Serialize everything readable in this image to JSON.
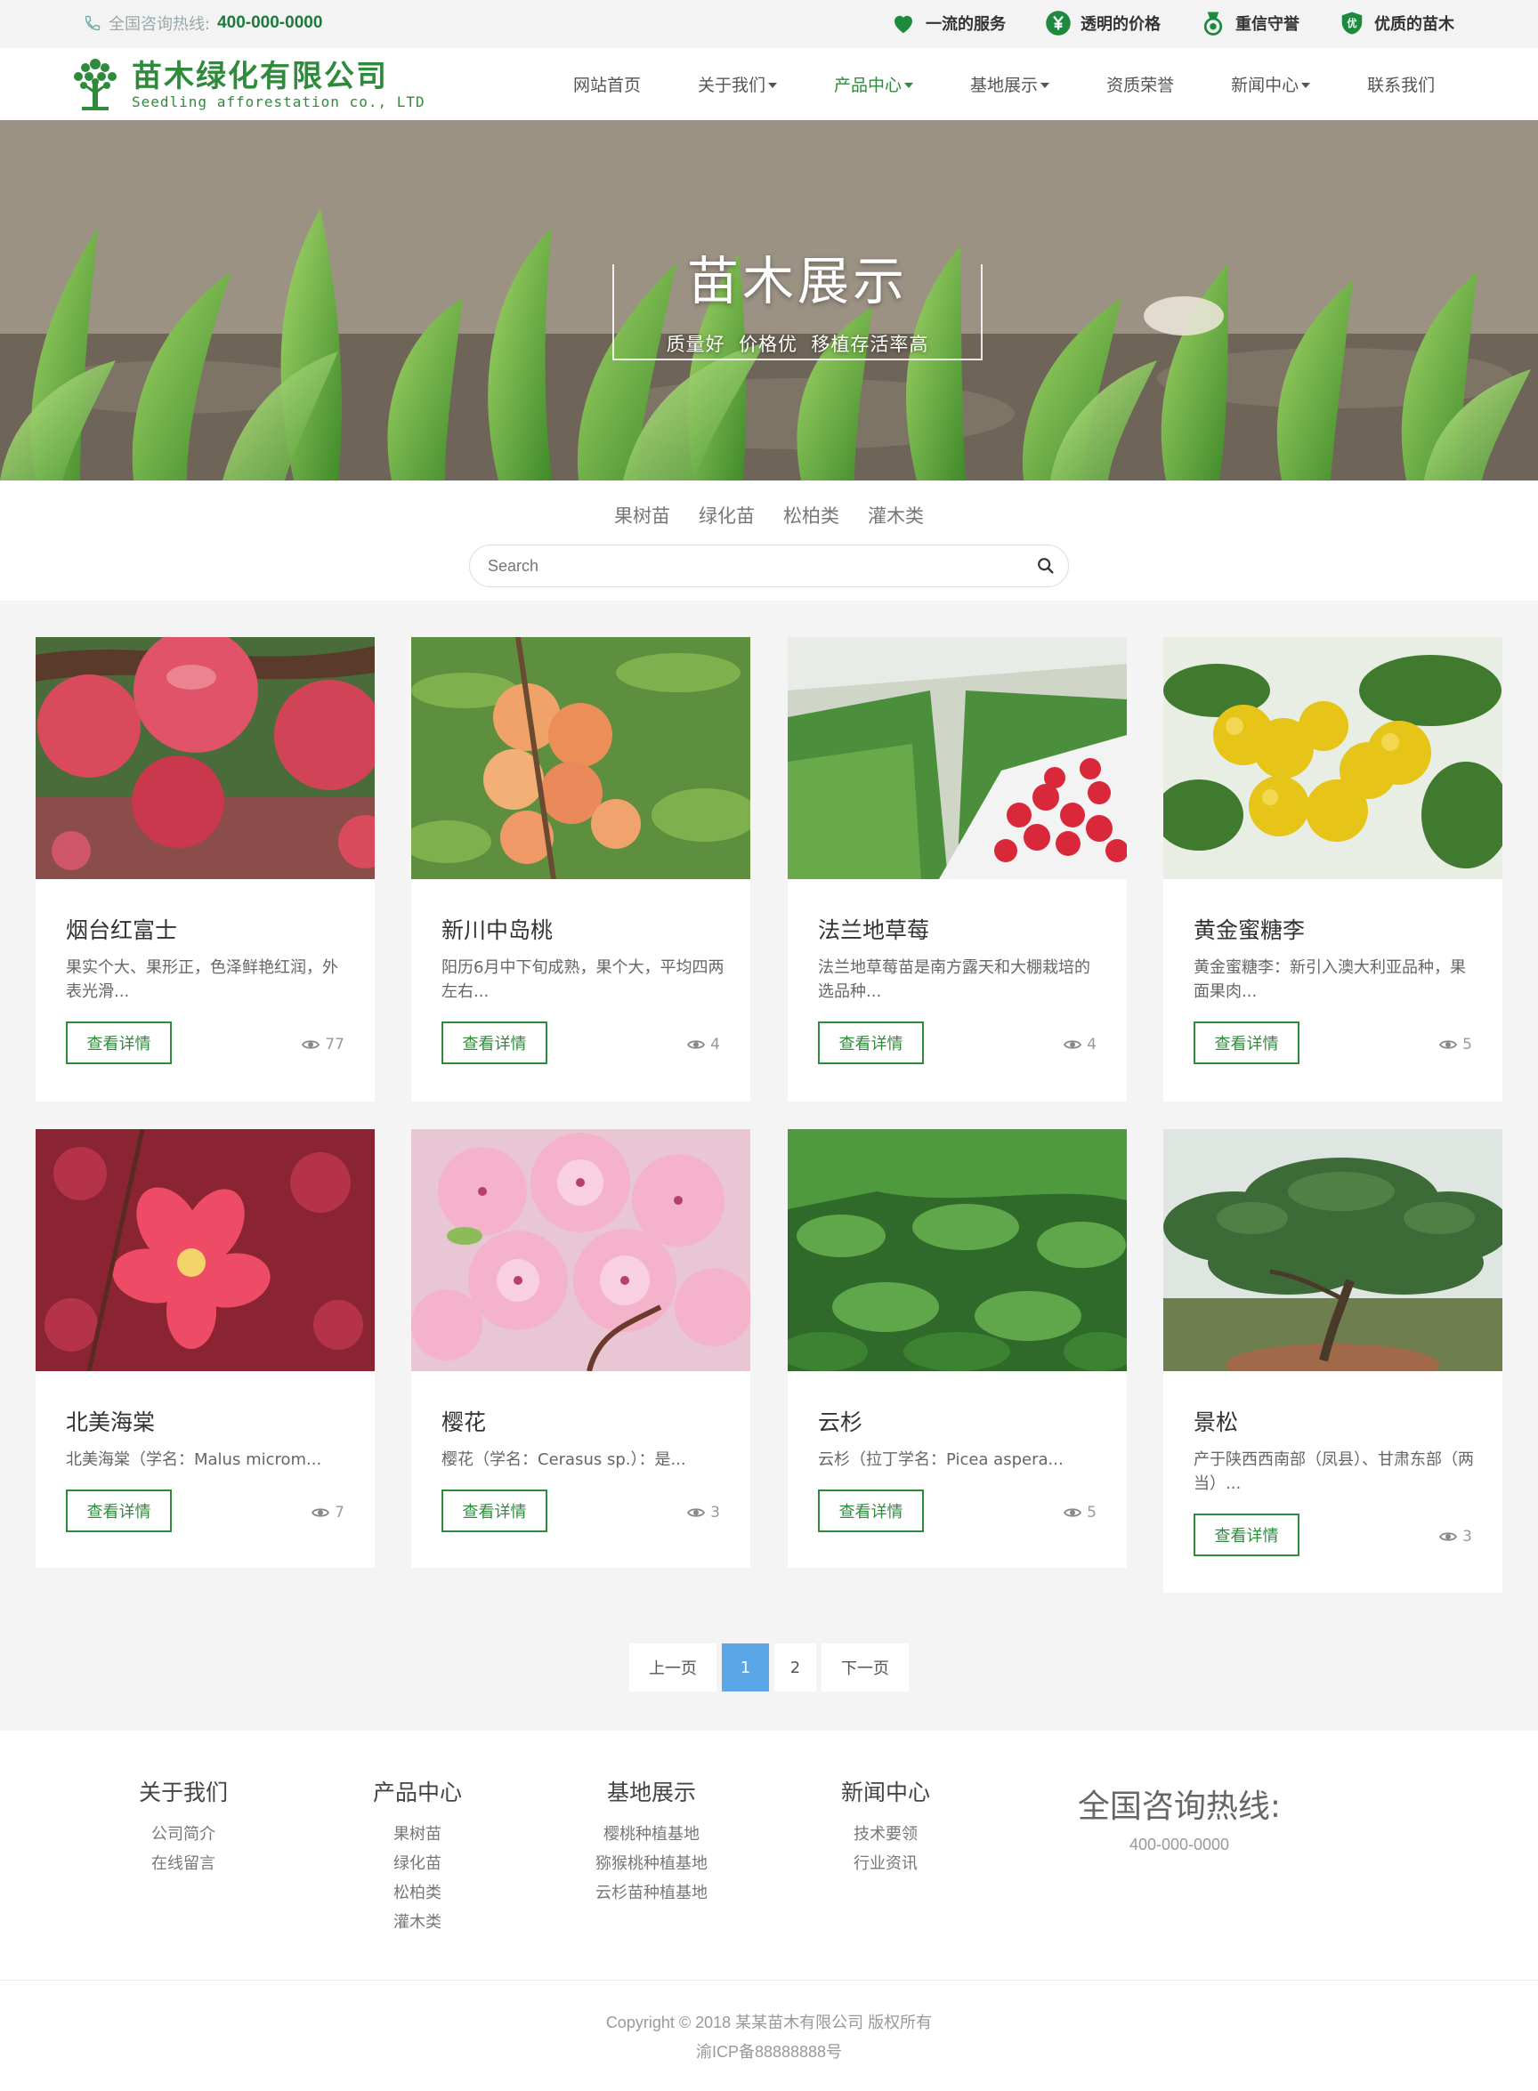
{
  "topbar": {
    "hotline_label": "全国咨询热线:",
    "hotline_number": "400-000-0000",
    "badges": [
      "一流的服务",
      "透明的价格",
      "重信守誉",
      "优质的苗木"
    ]
  },
  "logo": {
    "cn": "苗木绿化有限公司",
    "en": "Seedling afforestation co., LTD"
  },
  "nav": {
    "items": [
      {
        "label": "网站首页"
      },
      {
        "label": "关于我们"
      },
      {
        "label": "产品中心"
      },
      {
        "label": "基地展示"
      },
      {
        "label": "资质荣誉"
      },
      {
        "label": "新闻中心"
      },
      {
        "label": "联系我们"
      }
    ]
  },
  "banner": {
    "title": "苗木展示",
    "subtitle": "质量好  价格优  移植存活率高"
  },
  "filter": {
    "categories": [
      "果树苗",
      "绿化苗",
      "松柏类",
      "灌木类"
    ],
    "search_placeholder": "Search"
  },
  "products": [
    {
      "name": "烟台红富士",
      "desc": "果实个大、果形正，色泽鲜艳红润，外表光滑...",
      "button": "查看详情",
      "views": "77"
    },
    {
      "name": "新川中岛桃",
      "desc": "阳历6月中下旬成熟，果个大，平均四两左右...",
      "button": "查看详情",
      "views": "4"
    },
    {
      "name": "法兰地草莓",
      "desc": "法兰地草莓苗是南方露天和大棚栽培的选品种...",
      "button": "查看详情",
      "views": "4"
    },
    {
      "name": "黄金蜜糖李",
      "desc": "黄金蜜糖李：新引入澳大利亚品种，果面果肉...",
      "button": "查看详情",
      "views": "5"
    },
    {
      "name": "北美海棠",
      "desc": "北美海棠（学名：Malus microm...",
      "button": "查看详情",
      "views": "7"
    },
    {
      "name": "樱花",
      "desc": "樱花（学名：Cerasus sp.）：是...",
      "button": "查看详情",
      "views": "3"
    },
    {
      "name": "云杉",
      "desc": "云杉（拉丁学名：Picea aspera...",
      "button": "查看详情",
      "views": "5"
    },
    {
      "name": "景松",
      "desc": "产于陕西西南部（凤县）、甘肃东部（两当）...",
      "button": "查看详情",
      "views": "3"
    }
  ],
  "pagination": {
    "prev": "上一页",
    "page1": "1",
    "page2": "2",
    "next": "下一页"
  },
  "footer": {
    "columns": [
      {
        "title": "关于我们",
        "links": [
          "公司简介",
          "在线留言"
        ]
      },
      {
        "title": "产品中心",
        "links": [
          "果树苗",
          "绿化苗",
          "松柏类",
          "灌木类"
        ]
      },
      {
        "title": "基地展示",
        "links": [
          "樱桃种植基地",
          "猕猴桃种植基地",
          "云杉苗种植基地"
        ]
      },
      {
        "title": "新闻中心",
        "links": [
          "技术要领",
          "行业资讯"
        ]
      }
    ],
    "hotline_title": "全国咨询热线:",
    "hotline_number": "400-000-0000",
    "copyright": "Copyright © 2018 某某苗木有限公司 版权所有",
    "icp": "渝ICP备88888888号"
  },
  "colors": {
    "brand": "#2f8b3c",
    "page_active": "#5aa6e6",
    "bg": "#f4f4f4"
  }
}
